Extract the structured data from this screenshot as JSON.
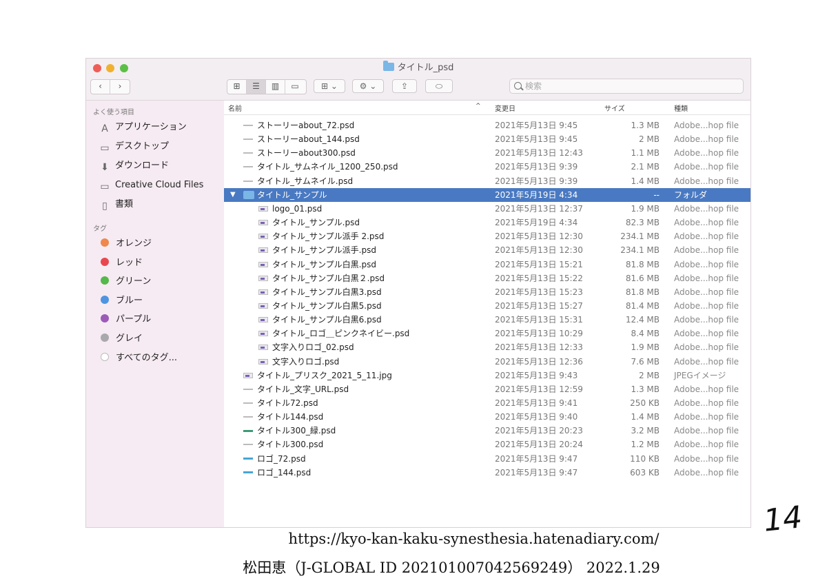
{
  "window": {
    "title": "タイトル_psd"
  },
  "toolbar": {
    "back_label": "‹",
    "forward_label": "›",
    "view_icon": "⊞",
    "group_label": "⊞ ⌄",
    "action_label": "⚙ ⌄",
    "share_label": "⇪",
    "tag_label": "⬭"
  },
  "search": {
    "placeholder": "検索"
  },
  "sidebar": {
    "favorites_heading": "よく使う項目",
    "favorites": [
      {
        "label": "アプリケーション",
        "icon": "applications-icon"
      },
      {
        "label": "デスクトップ",
        "icon": "desktop-icon"
      },
      {
        "label": "ダウンロード",
        "icon": "downloads-icon"
      },
      {
        "label": "Creative Cloud Files",
        "icon": "folder-icon"
      },
      {
        "label": "書類",
        "icon": "documents-icon"
      }
    ],
    "tags_heading": "タグ",
    "tags": [
      {
        "label": "オレンジ",
        "color": "#f0874c"
      },
      {
        "label": "レッド",
        "color": "#e9474f"
      },
      {
        "label": "グリーン",
        "color": "#55b84a"
      },
      {
        "label": "ブルー",
        "color": "#4f94e0"
      },
      {
        "label": "パープル",
        "color": "#9d5bb8"
      },
      {
        "label": "グレイ",
        "color": "#a9a8ad"
      },
      {
        "label": "すべてのタグ...",
        "color": "#ffffff"
      }
    ]
  },
  "columns": {
    "name": "名前",
    "date": "変更日",
    "size": "サイズ",
    "kind": "種類"
  },
  "rows": [
    {
      "name": "ストーリーabout_72.psd",
      "date": "2021年5月13日 9:45",
      "size": "1.3 MB",
      "kind": "Adobe...hop file"
    },
    {
      "name": "ストーリーabout_144.psd",
      "date": "2021年5月13日 9:45",
      "size": "2 MB",
      "kind": "Adobe...hop file"
    },
    {
      "name": "ストーリーabout300.psd",
      "date": "2021年5月13日 12:43",
      "size": "1.1 MB",
      "kind": "Adobe...hop file"
    },
    {
      "name": "タイトル_サムネイル_1200_250.psd",
      "date": "2021年5月13日 9:39",
      "size": "2.1 MB",
      "kind": "Adobe...hop file"
    },
    {
      "name": "タイトル_サムネイル.psd",
      "date": "2021年5月13日 9:39",
      "size": "1.4 MB",
      "kind": "Adobe...hop file"
    },
    {
      "name": "タイトル_サンプル",
      "date": "2021年5月19日 4:34",
      "size": "--",
      "kind": "フォルダ"
    },
    {
      "name": "logo_01.psd",
      "date": "2021年5月13日 12:37",
      "size": "1.9 MB",
      "kind": "Adobe...hop file"
    },
    {
      "name": "タイトル_サンプル.psd",
      "date": "2021年5月19日 4:34",
      "size": "82.3 MB",
      "kind": "Adobe...hop file"
    },
    {
      "name": "タイトル_サンプル派手 2.psd",
      "date": "2021年5月13日 12:30",
      "size": "234.1 MB",
      "kind": "Adobe...hop file"
    },
    {
      "name": "タイトル_サンプル派手.psd",
      "date": "2021年5月13日 12:30",
      "size": "234.1 MB",
      "kind": "Adobe...hop file"
    },
    {
      "name": "タイトル_サンプル白黒.psd",
      "date": "2021年5月13日 15:21",
      "size": "81.8 MB",
      "kind": "Adobe...hop file"
    },
    {
      "name": "タイトル_サンプル白黒２.psd",
      "date": "2021年5月13日 15:22",
      "size": "81.6 MB",
      "kind": "Adobe...hop file"
    },
    {
      "name": "タイトル_サンプル白黒3.psd",
      "date": "2021年5月13日 15:23",
      "size": "81.8 MB",
      "kind": "Adobe...hop file"
    },
    {
      "name": "タイトル_サンプル白黒5.psd",
      "date": "2021年5月13日 15:27",
      "size": "81.4 MB",
      "kind": "Adobe...hop file"
    },
    {
      "name": "タイトル_サンプル白黒6.psd",
      "date": "2021年5月13日 15:31",
      "size": "12.4 MB",
      "kind": "Adobe...hop file"
    },
    {
      "name": "タイトル_ロゴ＿ピンクネイビー.psd",
      "date": "2021年5月13日 10:29",
      "size": "8.4 MB",
      "kind": "Adobe...hop file"
    },
    {
      "name": "文字入りロゴ_02.psd",
      "date": "2021年5月13日 12:33",
      "size": "1.9 MB",
      "kind": "Adobe...hop file"
    },
    {
      "name": "文字入りロゴ.psd",
      "date": "2021年5月13日 12:36",
      "size": "7.6 MB",
      "kind": "Adobe...hop file"
    },
    {
      "name": "タイトル_プリスク_2021_5_11.jpg",
      "date": "2021年5月13日 9:43",
      "size": "2 MB",
      "kind": "JPEGイメージ"
    },
    {
      "name": "タイトル_文字_URL.psd",
      "date": "2021年5月13日 12:59",
      "size": "1.3 MB",
      "kind": "Adobe...hop file"
    },
    {
      "name": "タイトル72.psd",
      "date": "2021年5月13日 9:41",
      "size": "250 KB",
      "kind": "Adobe...hop file"
    },
    {
      "name": "タイトル144.psd",
      "date": "2021年5月13日 9:40",
      "size": "1.4 MB",
      "kind": "Adobe...hop file"
    },
    {
      "name": "タイトル300_緑.psd",
      "date": "2021年5月13日 20:23",
      "size": "3.2 MB",
      "kind": "Adobe...hop file"
    },
    {
      "name": "タイトル300.psd",
      "date": "2021年5月13日 20:24",
      "size": "1.2 MB",
      "kind": "Adobe...hop file"
    },
    {
      "name": "ロゴ_72.psd",
      "date": "2021年5月13日 9:47",
      "size": "110 KB",
      "kind": "Adobe...hop file"
    },
    {
      "name": "ロゴ_144.psd",
      "date": "2021年5月13日 9:47",
      "size": "603 KB",
      "kind": "Adobe...hop file"
    }
  ],
  "footer": {
    "url": "https://kyo-kan-kaku-synesthesia.hatenadiary.com/",
    "id_line": "松田恵（J-GLOBAL ID 202101007042569249） 2022.1.29",
    "page_number": "14"
  }
}
